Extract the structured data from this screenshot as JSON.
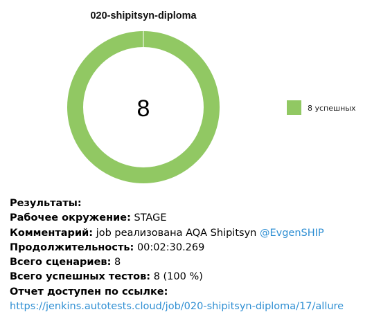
{
  "chart_data": {
    "type": "pie",
    "variant": "donut",
    "title": "020-shipitsyn-diploma",
    "center_label": "8",
    "categories": [
      "8 успешных"
    ],
    "values": [
      8
    ],
    "colors": [
      "#91c863"
    ],
    "legend_position": "right"
  },
  "info": {
    "results_label": "Результаты:",
    "env_label": "Рабочее окружение:",
    "env_value": "STAGE",
    "comment_label": "Комментарий:",
    "comment_value": "job реализована AQA Shipitsyn",
    "comment_mention": "@EvgenSHIP",
    "duration_label": "Продолжительность:",
    "duration_value": "00:02:30.269",
    "scenarios_label": "Всего сценариев:",
    "scenarios_value": "8",
    "passed_label": "Всего успешных тестов:",
    "passed_value": "8 (100 %)",
    "report_label": "Отчет доступен по ссылке:",
    "report_link": "https://jenkins.autotests.cloud/job/020-shipitsyn-diploma/17/allure"
  }
}
